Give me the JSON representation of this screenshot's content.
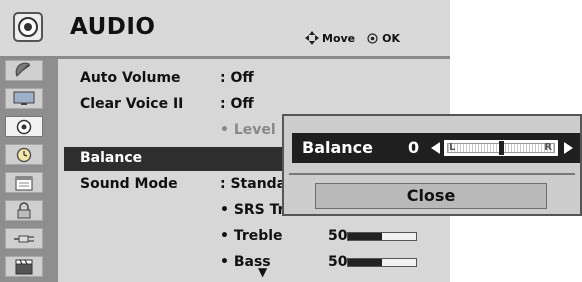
{
  "header": {
    "title": "AUDIO",
    "move_label": "Move",
    "ok_label": "OK"
  },
  "sidebar": {
    "items": [
      {
        "icon": "satellite-dish-icon"
      },
      {
        "icon": "tv-screen-icon"
      },
      {
        "icon": "speaker-audio-icon",
        "active": true
      },
      {
        "icon": "clock-icon"
      },
      {
        "icon": "calendar-icon"
      },
      {
        "icon": "lock-icon"
      },
      {
        "icon": "input-plug-icon"
      },
      {
        "icon": "film-clapboard-icon"
      }
    ]
  },
  "rows": {
    "auto_volume": {
      "label": "Auto Volume",
      "value": ": Off"
    },
    "clear_voice": {
      "label": "Clear Voice II",
      "value": ": Off"
    },
    "level": {
      "value": "• Level"
    },
    "balance": {
      "label": "Balance"
    },
    "sound_mode": {
      "label": "Sound Mode",
      "value": ": Standard"
    },
    "srs": {
      "value": "• SRS TruSu"
    },
    "treble": {
      "value": "• Treble",
      "number": "50",
      "fraction": 0.5
    },
    "bass": {
      "value": "• Bass",
      "number": "50",
      "fraction": 0.5
    }
  },
  "popup": {
    "label": "Balance",
    "value": "0",
    "slider_left": "L",
    "slider_right": "R",
    "slider_position": 0.5,
    "close_label": "Close"
  }
}
